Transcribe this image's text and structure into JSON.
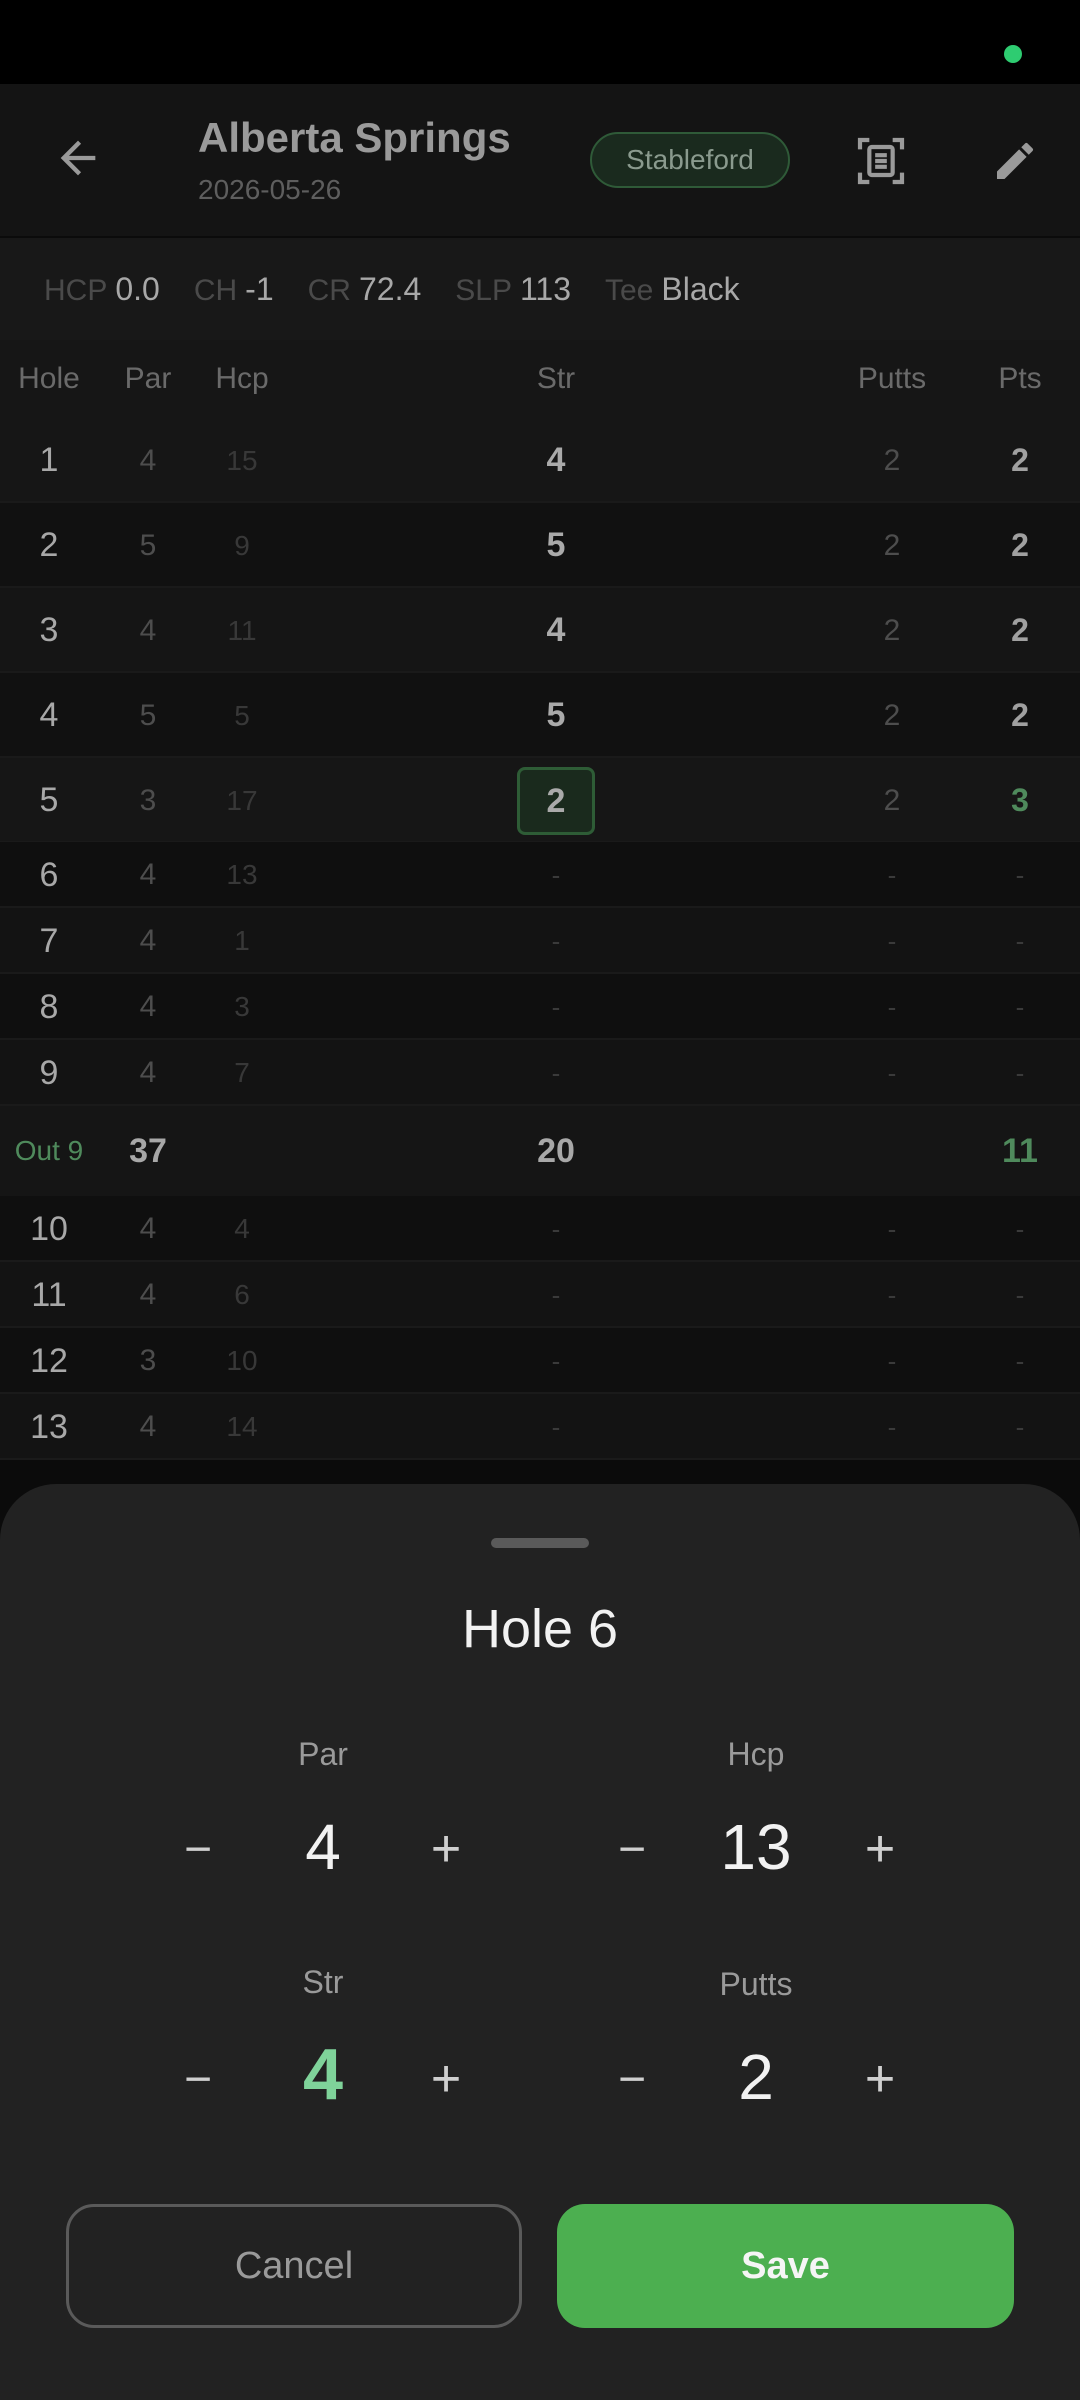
{
  "colors": {
    "accent": "#4caf50",
    "status_dot": "#2ecc71",
    "highlight_green": "#7fd39a"
  },
  "header": {
    "title": "Alberta Springs",
    "date": "2026-05-26",
    "badge": "Stableford",
    "icons": [
      "arrow-back-icon",
      "scan-document-icon",
      "pencil-icon"
    ]
  },
  "info": {
    "hcp_label": "HCP",
    "hcp_value": "0.0",
    "ch_label": "CH",
    "ch_value": "-1",
    "cr_label": "CR",
    "cr_value": "72.4",
    "slp_label": "SLP",
    "slp_value": "113",
    "tee_label": "Tee",
    "tee_value": "Black"
  },
  "table": {
    "columns": [
      "Hole",
      "Par",
      "Hcp",
      "Str",
      "Putts",
      "Pts"
    ],
    "rows": [
      {
        "hole": "1",
        "par": "4",
        "hcp": "15",
        "str": "4",
        "putts": "2",
        "pts": "2"
      },
      {
        "hole": "2",
        "par": "5",
        "hcp": "9",
        "str": "5",
        "putts": "2",
        "pts": "2"
      },
      {
        "hole": "3",
        "par": "4",
        "hcp": "11",
        "str": "4",
        "putts": "2",
        "pts": "2"
      },
      {
        "hole": "4",
        "par": "5",
        "hcp": "5",
        "str": "5",
        "putts": "2",
        "pts": "2"
      },
      {
        "hole": "5",
        "par": "3",
        "hcp": "17",
        "str": "2",
        "putts": "2",
        "pts": "3"
      },
      {
        "hole": "6",
        "par": "4",
        "hcp": "13",
        "str": "-",
        "putts": "-",
        "pts": "-"
      },
      {
        "hole": "7",
        "par": "4",
        "hcp": "1",
        "str": "-",
        "putts": "-",
        "pts": "-"
      },
      {
        "hole": "8",
        "par": "4",
        "hcp": "3",
        "str": "-",
        "putts": "-",
        "pts": "-"
      },
      {
        "hole": "9",
        "par": "4",
        "hcp": "7",
        "str": "-",
        "putts": "-",
        "pts": "-"
      },
      {
        "hole": "10",
        "par": "4",
        "hcp": "4",
        "str": "-",
        "putts": "-",
        "pts": "-"
      },
      {
        "hole": "11",
        "par": "4",
        "hcp": "6",
        "str": "-",
        "putts": "-",
        "pts": "-"
      },
      {
        "hole": "12",
        "par": "3",
        "hcp": "10",
        "str": "-",
        "putts": "-",
        "pts": "-"
      },
      {
        "hole": "13",
        "par": "4",
        "hcp": "14",
        "str": "-",
        "putts": "-",
        "pts": "-"
      }
    ],
    "out": {
      "label": "Out 9",
      "par": "37",
      "str": "20",
      "pts": "11"
    }
  },
  "sheet": {
    "title": "Hole 6",
    "par_label": "Par",
    "par_value": "4",
    "hcp_label": "Hcp",
    "hcp_value": "13",
    "str_label": "Str",
    "str_value": "4",
    "putts_label": "Putts",
    "putts_value": "2",
    "minus": "−",
    "plus": "+",
    "cancel": "Cancel",
    "save": "Save"
  }
}
